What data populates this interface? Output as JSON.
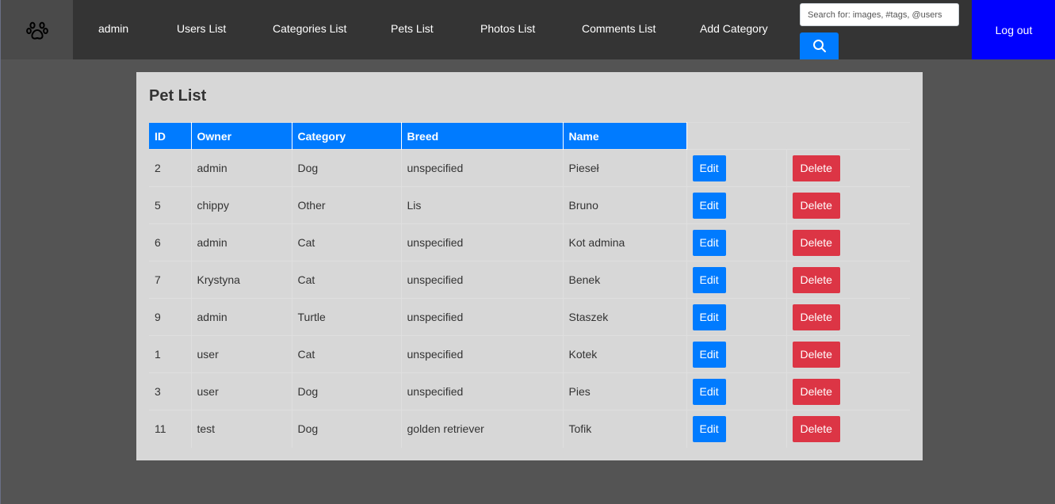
{
  "navbar": {
    "logo_icon": "paw-icon",
    "links": [
      "admin",
      "Users List",
      "Categories List",
      "Pets List",
      "Photos List",
      "Comments List",
      "Add Category"
    ],
    "search": {
      "placeholder": "Search for: images, #tags, @users",
      "button_icon": "search-icon"
    },
    "logout_label": "Log out",
    "colors": {
      "bar": "#343434",
      "logout": "#0000ff",
      "search_button": "#007bff"
    }
  },
  "panel": {
    "title": "Pet List",
    "columns": [
      "ID",
      "Owner",
      "Category",
      "Breed",
      "Name"
    ],
    "edit_label": "Edit",
    "delete_label": "Delete",
    "rows": [
      [
        "2",
        "admin",
        "Dog",
        "unspecified",
        "Pieseł"
      ],
      [
        "5",
        "chippy",
        "Other",
        "Lis",
        "Bruno"
      ],
      [
        "6",
        "admin",
        "Cat",
        "unspecified",
        "Kot admina"
      ],
      [
        "7",
        "Krystyna",
        "Cat",
        "unspecified",
        "Benek"
      ],
      [
        "9",
        "admin",
        "Turtle",
        "unspecified",
        "Staszek"
      ],
      [
        "1",
        "user",
        "Cat",
        "unspecified",
        "Kotek"
      ],
      [
        "3",
        "user",
        "Dog",
        "unspecified",
        "Pies"
      ],
      [
        "11",
        "test",
        "Dog",
        "golden retriever",
        "Tofik"
      ]
    ],
    "colors": {
      "header": "#007bff",
      "edit": "#007bff",
      "delete": "#dc3545"
    }
  }
}
